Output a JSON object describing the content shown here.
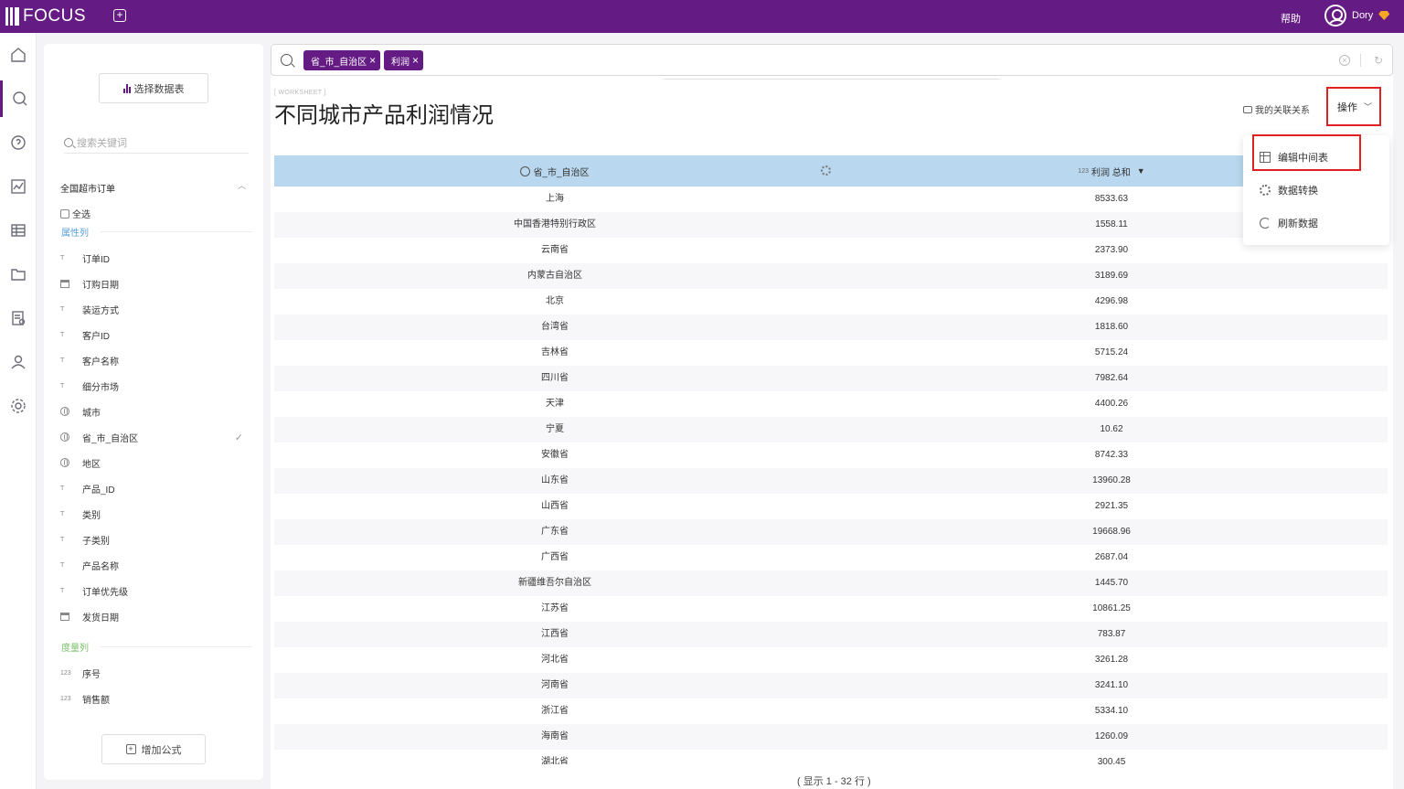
{
  "app": {
    "name": "FOCUS",
    "help": "帮助",
    "user": "Dory",
    "accent": "#651b84"
  },
  "rail": [
    {
      "icon": "home-icon"
    },
    {
      "icon": "search-icon",
      "active": true
    },
    {
      "icon": "help-icon"
    },
    {
      "icon": "chart-icon"
    },
    {
      "icon": "table-icon"
    },
    {
      "icon": "folder-icon"
    },
    {
      "icon": "task-icon"
    },
    {
      "icon": "user-icon"
    },
    {
      "icon": "settings-icon"
    }
  ],
  "panel": {
    "select_table": "选择数据表",
    "search_placeholder": "搜索关键词",
    "source": "全国超市订单",
    "select_all": "全选",
    "attr_section": "属性列",
    "measure_section": "度量列",
    "attributes": [
      {
        "type": "text",
        "type_label": "T",
        "name": "订单ID"
      },
      {
        "type": "date",
        "type_label": "",
        "name": "订购日期"
      },
      {
        "type": "text",
        "type_label": "T",
        "name": "装运方式"
      },
      {
        "type": "text",
        "type_label": "T",
        "name": "客户ID"
      },
      {
        "type": "text",
        "type_label": "T",
        "name": "客户名称"
      },
      {
        "type": "text",
        "type_label": "T",
        "name": "细分市场"
      },
      {
        "type": "geo",
        "type_label": "",
        "name": "城市"
      },
      {
        "type": "geo",
        "type_label": "",
        "name": "省_市_自治区",
        "checked": true
      },
      {
        "type": "geo",
        "type_label": "",
        "name": "地区"
      },
      {
        "type": "text",
        "type_label": "T",
        "name": "产品_ID"
      },
      {
        "type": "text",
        "type_label": "T",
        "name": "类别"
      },
      {
        "type": "text",
        "type_label": "T",
        "name": "子类别"
      },
      {
        "type": "text",
        "type_label": "T",
        "name": "产品名称"
      },
      {
        "type": "text",
        "type_label": "T",
        "name": "订单优先级"
      },
      {
        "type": "date",
        "type_label": "",
        "name": "发货日期"
      }
    ],
    "measures": [
      {
        "type_label": "123",
        "name": "序号"
      },
      {
        "type_label": "123",
        "name": "销售额"
      }
    ],
    "add_formula": "增加公式"
  },
  "search": {
    "chips": [
      "省_市_自治区",
      "利润"
    ]
  },
  "worksheet": {
    "tag": "[ WORKSHEET ]",
    "title": "不同城市产品利润情况",
    "assoc": "我的关联关系",
    "ops": "操作"
  },
  "table": {
    "col1": "省_市_自治区",
    "col2_type": "123",
    "col2": "利润 总和",
    "rows": [
      [
        "上海",
        "8533.63"
      ],
      [
        "中国香港特别行政区",
        "1558.11"
      ],
      [
        "云南省",
        "2373.90"
      ],
      [
        "内蒙古自治区",
        "3189.69"
      ],
      [
        "北京",
        "4296.98"
      ],
      [
        "台湾省",
        "1818.60"
      ],
      [
        "吉林省",
        "5715.24"
      ],
      [
        "四川省",
        "7982.64"
      ],
      [
        "天津",
        "4400.26"
      ],
      [
        "宁夏",
        "10.62"
      ],
      [
        "安徽省",
        "8742.33"
      ],
      [
        "山东省",
        "13960.28"
      ],
      [
        "山西省",
        "2921.35"
      ],
      [
        "广东省",
        "19668.96"
      ],
      [
        "广西省",
        "2687.04"
      ],
      [
        "新疆维吾尔自治区",
        "1445.70"
      ],
      [
        "江苏省",
        "10861.25"
      ],
      [
        "江西省",
        "783.87"
      ],
      [
        "河北省",
        "3261.28"
      ],
      [
        "河南省",
        "3241.10"
      ],
      [
        "浙江省",
        "5334.10"
      ],
      [
        "海南省",
        "1260.09"
      ],
      [
        "湖北省",
        "300.45"
      ]
    ],
    "footer": "( 显示 1 - 32 行 )"
  },
  "menu": [
    {
      "icon": "grid-icon",
      "label": "编辑中间表"
    },
    {
      "icon": "gear-icon",
      "label": "数据转换"
    },
    {
      "icon": "refresh-icon",
      "label": "刷新数据"
    }
  ]
}
